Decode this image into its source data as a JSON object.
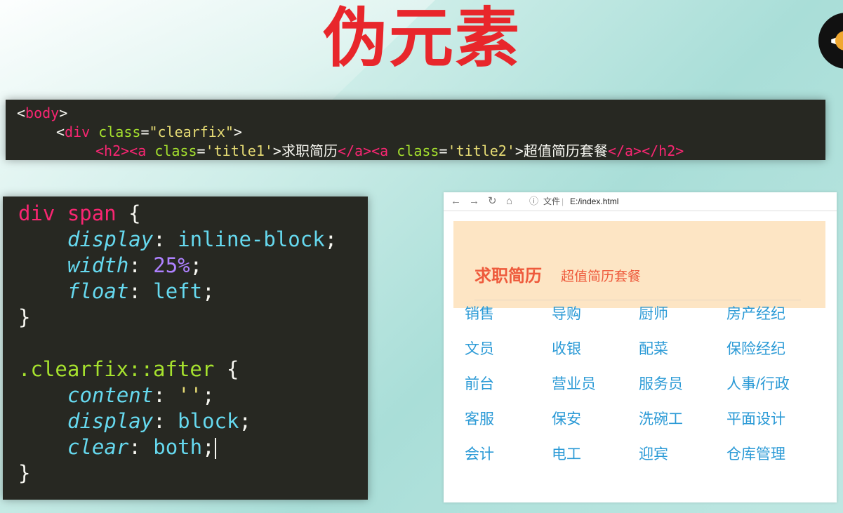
{
  "slide": {
    "title": "伪元素"
  },
  "html_code": {
    "line1": {
      "open": "<",
      "tag": "body",
      "close": ">"
    },
    "line2": {
      "open": "<",
      "tag": "div",
      "attr": "class",
      "eq": "=",
      "value": "\"clearfix\"",
      "close": ">"
    },
    "line3": {
      "h2_open": "<h2>",
      "a1_open": "<a",
      "a1_attr": "class",
      "a1_eq": "=",
      "a1_value": "'title1'",
      "a1_close": ">",
      "a1_text": "求职简历",
      "a1_end": "</a>",
      "a2_open": "<a",
      "a2_attr": "class",
      "a2_eq": "=",
      "a2_value": "'title2'",
      "a2_close": ">",
      "a2_text": "超值简历套餐",
      "a2_end": "</a>",
      "h2_end": "</h2>"
    }
  },
  "css_code": {
    "rule1": {
      "selector": "div span",
      "brace_open": "{",
      "decls": [
        {
          "prop": "display",
          "value": "inline-block"
        },
        {
          "prop": "width",
          "value": "25%"
        },
        {
          "prop": "float",
          "value": "left"
        }
      ],
      "brace_close": "}"
    },
    "rule2": {
      "selector": ".clearfix::after",
      "brace_open": "{",
      "decls": [
        {
          "prop": "content",
          "value": "''"
        },
        {
          "prop": "display",
          "value": "block"
        },
        {
          "prop": "clear",
          "value": "both"
        }
      ],
      "brace_close": "}"
    }
  },
  "browser": {
    "file_label": "文件",
    "url": "E:/index.html",
    "title1": "求职简历",
    "title2": "超值简历套餐",
    "jobs": [
      [
        "销售",
        "导购",
        "厨师",
        "房产经纪"
      ],
      [
        "文员",
        "收银",
        "配菜",
        "保险经纪"
      ],
      [
        "前台",
        "营业员",
        "服务员",
        "人事/行政"
      ],
      [
        "客服",
        "保安",
        "洗碗工",
        "平面设计"
      ],
      [
        "会计",
        "电工",
        "迎宾",
        "仓库管理"
      ]
    ]
  },
  "colors": {
    "title_red": "#e8262b",
    "header_bg": "#fde5c4",
    "title_orange": "#ee5a3c",
    "job_blue": "#2b9ad6",
    "code_bg": "#272822"
  }
}
